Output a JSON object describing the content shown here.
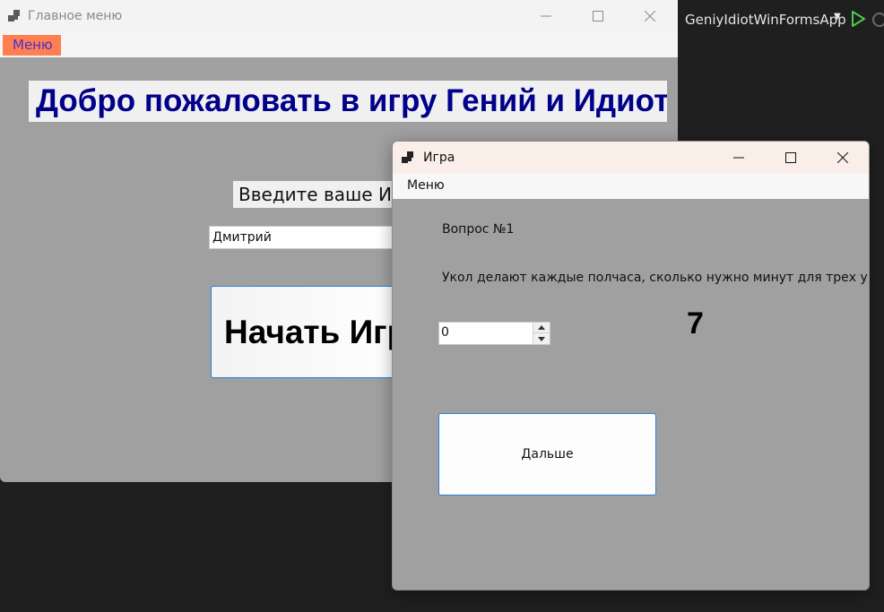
{
  "ide": {
    "project_name": "GeniyIdiotWinFormsApp",
    "colors": {
      "background": "#1f1f1f",
      "run_green": "#4ec94e"
    }
  },
  "main_window": {
    "title": "Главное меню",
    "menu_label": "Меню",
    "welcome_text": "Добро пожаловать в игру Гений и Идиот!",
    "name_label": "Введите ваше Имя",
    "name_value": "Дмитрий",
    "start_button": "Начать Игру",
    "colors": {
      "menu_bg": "#ff7f50",
      "menu_text": "#4b2bd6",
      "welcome_text": "#00008b",
      "client_bg": "#a0a0a0"
    }
  },
  "game_window": {
    "title": "Игра",
    "menu_label": "Меню",
    "question_number": "Вопрос №1",
    "question_text": "Укол делают каждые полчаса, сколько нужно минут для трех уколов",
    "answer_value": "0",
    "big_number": "7",
    "next_button": "Дальше",
    "colors": {
      "titlebar_bg": "#f9efe8",
      "button_border": "#2a7fd4"
    }
  }
}
